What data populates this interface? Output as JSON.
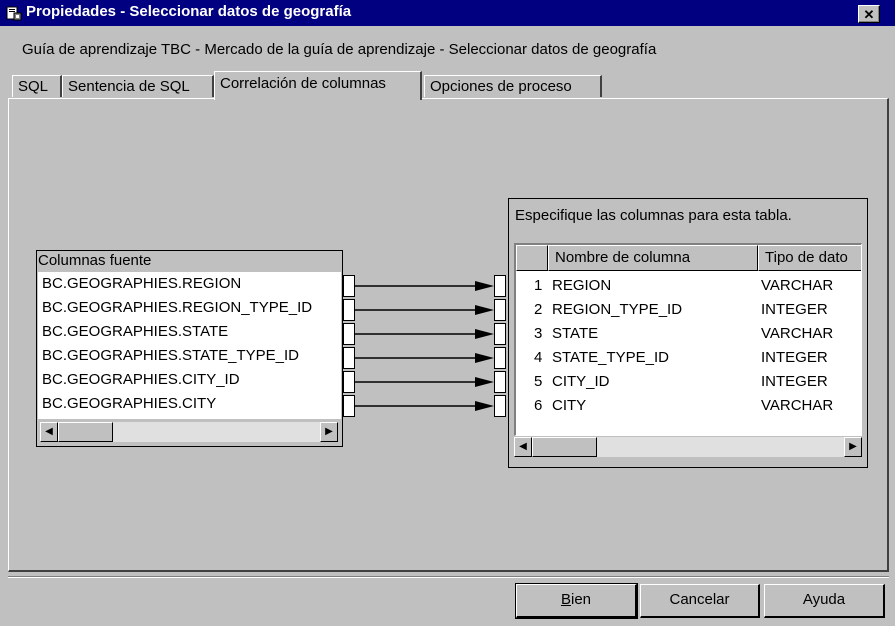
{
  "window": {
    "title": "Propiedades - Seleccionar datos de geografía",
    "subtitle": "Guía de aprendizaje TBC - Mercado de la guía de aprendizaje - Seleccionar datos de geografía",
    "close_glyph": "✕"
  },
  "tabs": [
    "SQL",
    "Sentencia de SQL",
    "Correlación de columnas",
    "Opciones de proceso"
  ],
  "active_tab": "Correlación de columnas",
  "source": {
    "header": "Columnas fuente",
    "columns": [
      "BC.GEOGRAPHIES.REGION",
      "BC.GEOGRAPHIES.REGION_TYPE_ID",
      "BC.GEOGRAPHIES.STATE",
      "BC.GEOGRAPHIES.STATE_TYPE_ID",
      "BC.GEOGRAPHIES.CITY_ID",
      "BC.GEOGRAPHIES.CITY"
    ]
  },
  "target": {
    "header": "Especifique las columnas para esta tabla.",
    "col_headers": [
      "Nombre de columna",
      "Tipo de dato"
    ],
    "rows": [
      {
        "num": "1",
        "name": "REGION",
        "type": "VARCHAR"
      },
      {
        "num": "2",
        "name": "REGION_TYPE_ID",
        "type": "INTEGER"
      },
      {
        "num": "3",
        "name": "STATE",
        "type": "VARCHAR"
      },
      {
        "num": "4",
        "name": "STATE_TYPE_ID",
        "type": "INTEGER"
      },
      {
        "num": "5",
        "name": "CITY_ID",
        "type": "INTEGER"
      },
      {
        "num": "6",
        "name": "CITY",
        "type": "VARCHAR"
      }
    ]
  },
  "buttons": {
    "ok": "Bien",
    "cancel": "Cancelar",
    "help": "Ayuda"
  },
  "scroll_arrows": {
    "left": "◀",
    "right": "▶"
  },
  "icons": [
    "app-icon",
    "close-icon",
    "scroll-left-icon",
    "scroll-right-icon",
    "arrow-connector"
  ],
  "colors": {
    "titlebar": "#000080",
    "dialog": "#c0c0c0",
    "field": "#ffffff"
  }
}
